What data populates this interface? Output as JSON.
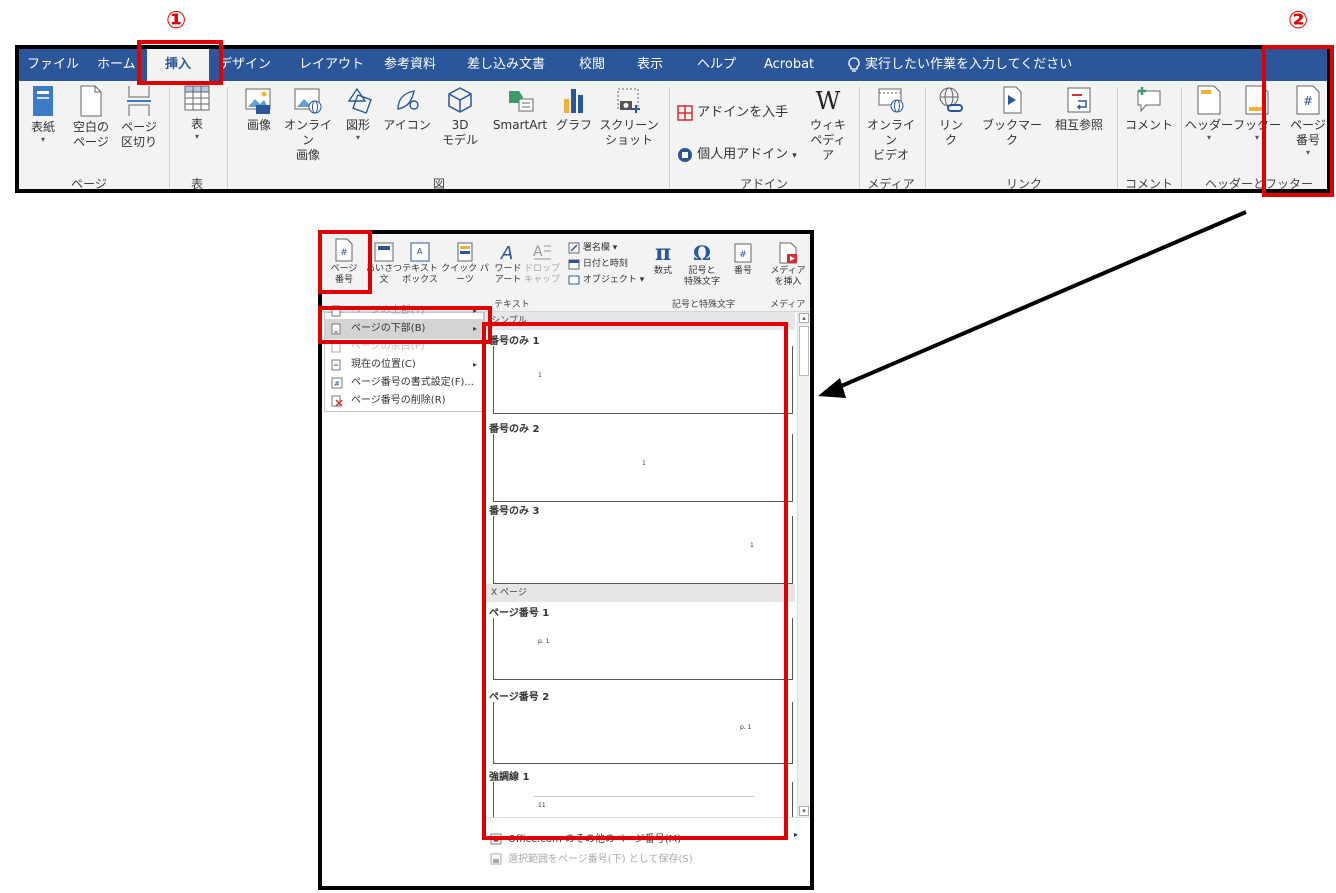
{
  "markers": {
    "one": "①",
    "two": "②"
  },
  "ribbon": {
    "tabs": [
      "ファイル",
      "ホーム",
      "挿入",
      "デザイン",
      "レイアウト",
      "参考資料",
      "差し込み文書",
      "校閲",
      "表示",
      "ヘルプ",
      "Acrobat"
    ],
    "active_tab": "挿入",
    "tell_me": "実行したい作業を入力してください",
    "commands": {
      "cover": "表紙",
      "blank": "空白の\nページ",
      "break": "ページ\n区切り",
      "table": "表",
      "picture": "画像",
      "online_picture": "オンライン\n画像",
      "shapes": "図形",
      "icons": "アイコン",
      "model3d": "3D\nモデル",
      "smartart": "SmartArt",
      "chart": "グラフ",
      "screenshot": "スクリーン\nショット",
      "get_addins": "アドインを入手",
      "my_addins": "個人用アドイン",
      "wikipedia": "ウィキ\nペディア",
      "online_video": "オンライン\nビデオ",
      "link": "リン\nク",
      "bookmark": "ブックマーク",
      "crossref": "相互参照",
      "comment": "コメント",
      "header": "ヘッダー",
      "footer": "フッター",
      "page_number": "ページ\n番号"
    },
    "groups": {
      "pages": "ページ",
      "tables": "表",
      "illustrations": "図",
      "addins": "アドイン",
      "media": "メディア",
      "links": "リンク",
      "comments": "コメント",
      "header_footer": "ヘッダーとフッター"
    }
  },
  "ribbon2": {
    "commands": {
      "page_number": "ページ\n番号",
      "greeting": "あいさつ\n文",
      "textbox": "テキスト\nボックス",
      "quickparts": "クイック パーツ",
      "wordart": "ワード\nアート",
      "dropcap": "ドロップ\nキャップ",
      "signature": "署名欄",
      "datetime": "日付と時刻",
      "object": "オブジェクト",
      "equation": "数式",
      "symbol": "記号と\n特殊文字",
      "number": "番号",
      "media": "メディア\nを挿入"
    },
    "groups": {
      "text": "テキスト",
      "symbols": "記号と特殊文字",
      "media": "メディア"
    }
  },
  "menu": {
    "items": [
      {
        "label": "ページの上部(T)"
      },
      {
        "label": "ページの下部(B)"
      },
      {
        "label": "ページの余白(P)"
      },
      {
        "label": "現在の位置(C)"
      },
      {
        "label": "ページ番号の書式設定(F)..."
      },
      {
        "label": "ページ番号の削除(R)"
      }
    ]
  },
  "gallery": {
    "section1": "シンプル",
    "section2": "X ページ",
    "items": [
      {
        "title": "番号のみ 1",
        "sample": "1"
      },
      {
        "title": "番号のみ 2",
        "sample": "1"
      },
      {
        "title": "番号のみ 3",
        "sample": "1"
      },
      {
        "title": "ページ番号 1",
        "sample": "p. 1"
      },
      {
        "title": "ページ番号 2",
        "sample": "p. 1"
      },
      {
        "title": "強調線 1",
        "sample": "11"
      }
    ],
    "more": "Office.com のその他のページ番号(M)",
    "save": "選択範囲をページ番号(下) として保存(S)"
  },
  "colors": {
    "tabbar": "#2b579a",
    "highlight": "#e00000",
    "word_blue": "#2b579a"
  }
}
